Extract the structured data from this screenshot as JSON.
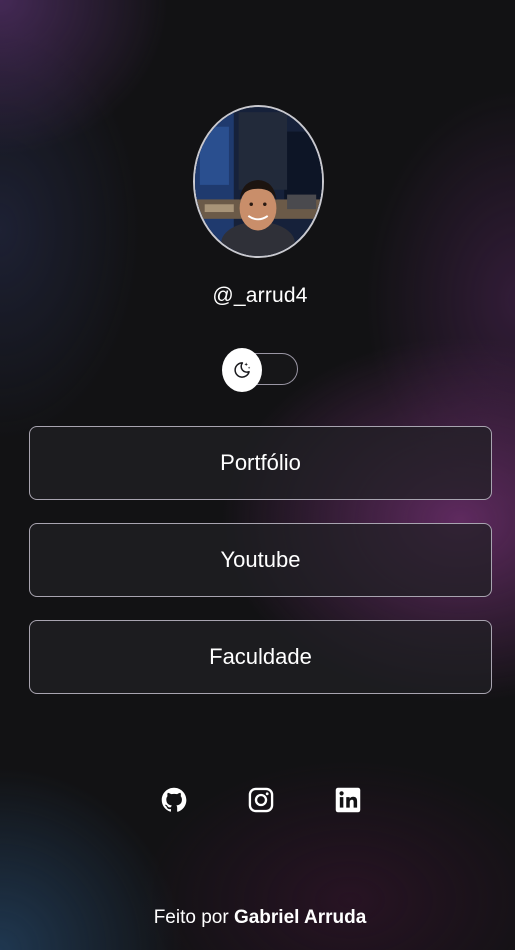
{
  "profile": {
    "username": "@_arrud4",
    "avatar_icon": "profile-photo"
  },
  "theme_toggle": {
    "icon": "moon-stars-icon",
    "state": "off"
  },
  "links": [
    {
      "label": "Portfólio"
    },
    {
      "label": "Youtube"
    },
    {
      "label": "Faculdade"
    }
  ],
  "socials": [
    {
      "icon": "github-icon"
    },
    {
      "icon": "instagram-icon"
    },
    {
      "icon": "linkedin-icon"
    }
  ],
  "footer": {
    "prefix": "Feito por ",
    "author": "Gabriel Arruda"
  },
  "colors": {
    "background": "#121214",
    "accent_glow": "#78327a",
    "button_border": "#a8a4b0",
    "text": "#ffffff"
  }
}
